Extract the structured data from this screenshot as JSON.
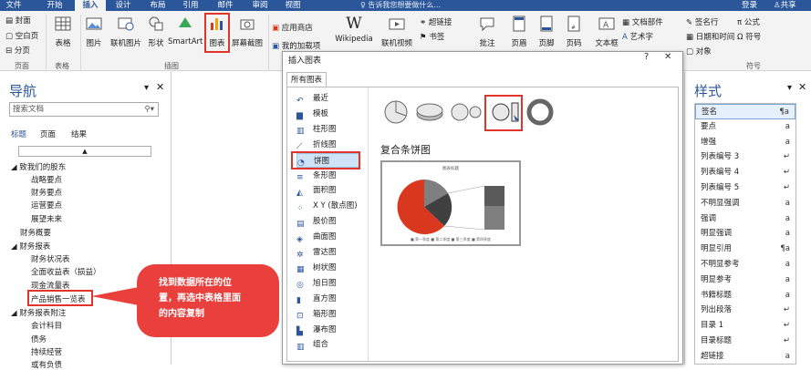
{
  "tabs": [
    "文件",
    "开始",
    "插入",
    "设计",
    "布局",
    "引用",
    "邮件",
    "审阅",
    "视图"
  ],
  "active_tab": "插入",
  "tell_me": "告诉我您想要做什么...",
  "login": "登录",
  "share": "共享",
  "ribbon": {
    "pages": [
      "封面",
      "空白页",
      "分页"
    ],
    "pages_group": "页面",
    "table": "表格",
    "tables_group": "表格",
    "picture": "图片",
    "online_picture": "联机图片",
    "shapes": "形状",
    "smartart": "SmartArt",
    "chart": "图表",
    "screenshot": "屏幕截图",
    "illustrations_group": "插图",
    "store": "应用商店",
    "my_addins": "我的加载项",
    "wikipedia": "Wikipedia",
    "online_video": "联机视频",
    "hyperlink": "超链接",
    "bookmark": "书签",
    "comment": "批注",
    "header": "页眉",
    "footer": "页脚",
    "page_number": "页码",
    "textbox": "文本框",
    "doc_parts": "文档部件",
    "wordart": "艺术字",
    "signature": "签名行",
    "datetime": "日期和时间",
    "object": "对象",
    "equation": "公式",
    "symbol": "符号",
    "symbols_group": "符号"
  },
  "nav": {
    "title": "导航",
    "search_placeholder": "搜索文档",
    "tabs": [
      "标题",
      "页面",
      "结果"
    ],
    "items": [
      "致我们的股东",
      "战略要点",
      "财务要点",
      "运营要点",
      "展望未来",
      "财务概要",
      "财务报表",
      "财务状况表",
      "全面收益表（损益）",
      "现金流量表",
      "产品销售一览表",
      "财务报表附注",
      "会计科目",
      "债务",
      "持续经营",
      "或有负债"
    ]
  },
  "dialog": {
    "title": "插入图表",
    "tab": "所有图表",
    "categories": [
      "最近",
      "模板",
      "柱形图",
      "折线图",
      "饼图",
      "条形图",
      "面积图",
      "X Y (散点图)",
      "股价图",
      "曲面图",
      "雷达图",
      "树状图",
      "旭日图",
      "直方图",
      "箱形图",
      "瀑布图",
      "组合"
    ],
    "selected_category": "饼图",
    "subtype_name": "复合条饼图",
    "preview_title": "图表标题",
    "preview_legend": "■ 第一季度  ■ 第二季度  ■ 第三季度  ■ 第四季度"
  },
  "styles": {
    "title": "样式",
    "items": [
      {
        "name": "签名",
        "mark": "¶a"
      },
      {
        "name": "要点",
        "mark": "a"
      },
      {
        "name": "增强",
        "mark": "a"
      },
      {
        "name": "列表编号 3",
        "mark": "↵"
      },
      {
        "name": "列表编号 4",
        "mark": "↵"
      },
      {
        "name": "列表编号 5",
        "mark": "↵"
      },
      {
        "name": "不明显强调",
        "mark": "a"
      },
      {
        "name": "强调",
        "mark": "a"
      },
      {
        "name": "明显强调",
        "mark": "a"
      },
      {
        "name": "明显引用",
        "mark": "¶a"
      },
      {
        "name": "不明显参考",
        "mark": "a"
      },
      {
        "name": "明显参考",
        "mark": "a"
      },
      {
        "name": "书籍标题",
        "mark": "a"
      },
      {
        "name": "列出段落",
        "mark": "↵"
      },
      {
        "name": "目录 1",
        "mark": "↵"
      },
      {
        "name": "目录标题",
        "mark": "↵"
      },
      {
        "name": "超链接",
        "mark": "a"
      }
    ]
  },
  "callout": {
    "line1": "找到数据所在的位",
    "line2": "置，再选中表格里面",
    "line3": "的内容复制"
  },
  "colors": {
    "accent": "#2b579a",
    "callout": "#e9403d",
    "pie_red": "#d9381e",
    "pie_grey": "#7f7f7f",
    "pie_dark": "#404040"
  }
}
